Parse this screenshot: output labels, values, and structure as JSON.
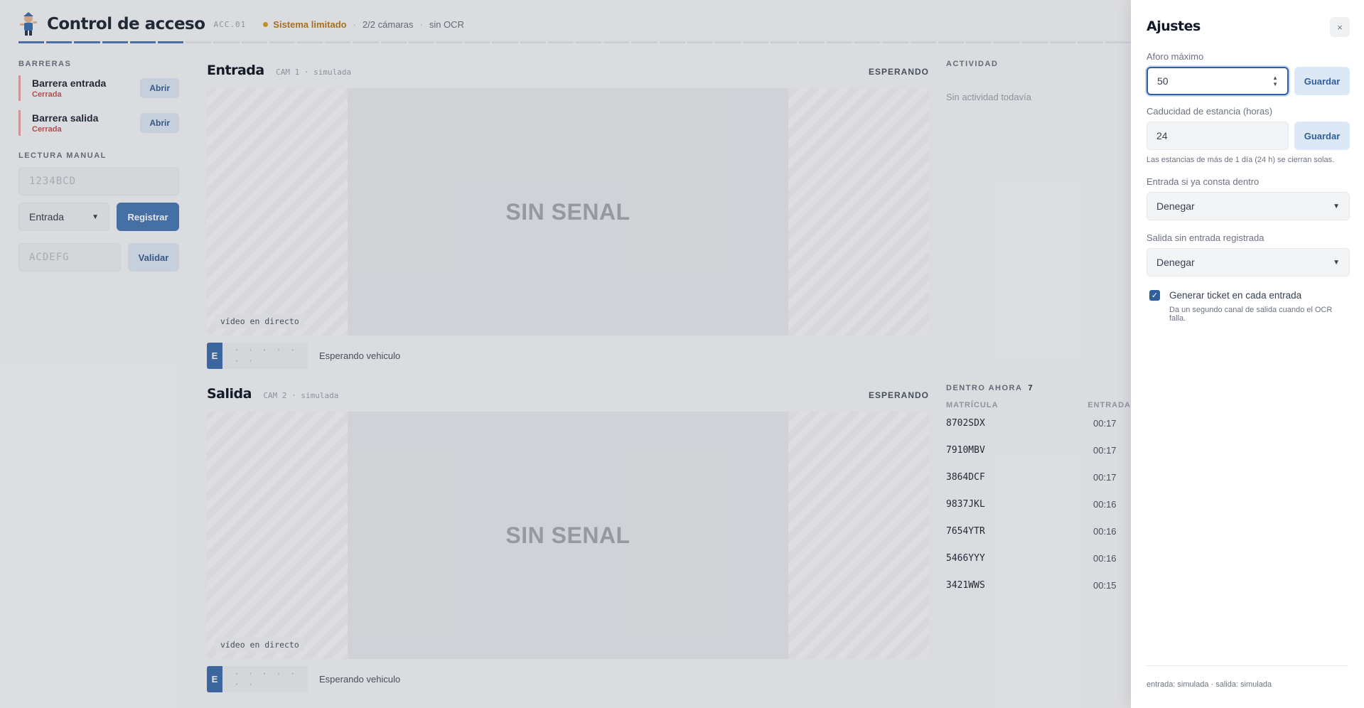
{
  "header": {
    "title": "Control de acceso",
    "code": "ACC.01",
    "status_main": "Sistema limitado",
    "cameras": "2/2 cámaras",
    "ocr": "sin OCR",
    "progress_segments_total": 40,
    "progress_segments_on": 6,
    "accent_color": "#4a79b4"
  },
  "barriers": {
    "label": "BARRERAS",
    "items": [
      {
        "name": "Barrera entrada",
        "state": "Cerrada",
        "action": "Abrir"
      },
      {
        "name": "Barrera salida",
        "state": "Cerrada",
        "action": "Abrir"
      }
    ]
  },
  "manual": {
    "label": "LECTURA MANUAL",
    "plate_placeholder": "1234BCD",
    "direction": "Entrada",
    "register": "Registrar",
    "ticket_placeholder": "ACDEFG",
    "validate": "Validar"
  },
  "cameras": [
    {
      "title": "Entrada",
      "sub": "CAM 1 · simulada",
      "state": "ESPERANDO",
      "no_signal": "SIN SENAL",
      "live": "vídeo en directo",
      "plate_badge": "E",
      "plate_text": "· · · · · · ·",
      "plate_msg": "Esperando vehiculo"
    },
    {
      "title": "Salida",
      "sub": "CAM 2 · simulada",
      "state": "ESPERANDO",
      "no_signal": "SIN SENAL",
      "live": "vídeo en directo",
      "plate_badge": "E",
      "plate_text": "· · · · · · ·",
      "plate_msg": "Esperando vehiculo"
    }
  ],
  "activity": {
    "label": "ACTIVIDAD",
    "empty": "Sin actividad todavía"
  },
  "inside": {
    "label": "DENTRO AHORA",
    "count": "7",
    "col_plate": "MATRÍCULA",
    "col_entry": "ENTRADA",
    "rows": [
      {
        "plate": "8702SDX",
        "time": "00:17"
      },
      {
        "plate": "7910MBV",
        "time": "00:17"
      },
      {
        "plate": "3864DCF",
        "time": "00:17"
      },
      {
        "plate": "9837JKL",
        "time": "00:16"
      },
      {
        "plate": "7654YTR",
        "time": "00:16"
      },
      {
        "plate": "5466YYY",
        "time": "00:16"
      },
      {
        "plate": "3421WWS",
        "time": "00:15"
      }
    ]
  },
  "settings": {
    "title": "Ajustes",
    "close": "×",
    "capacity_label": "Aforo máximo",
    "capacity_value": "50",
    "save": "Guardar",
    "expiry_label": "Caducidad de estancia (horas)",
    "expiry_value": "24",
    "expiry_hint": "Las estancias de más de 1 día (24 h) se cierran solas.",
    "entry_inside_label": "Entrada si ya consta dentro",
    "entry_inside_value": "Denegar",
    "exit_no_entry_label": "Salida sin entrada registrada",
    "exit_no_entry_value": "Denegar",
    "ticket_label": "Generar ticket en cada entrada",
    "ticket_checked": true,
    "ticket_hint": "Da un segundo canal de salida cuando el OCR falla.",
    "footer": "entrada: simulada · salida: simulada"
  }
}
